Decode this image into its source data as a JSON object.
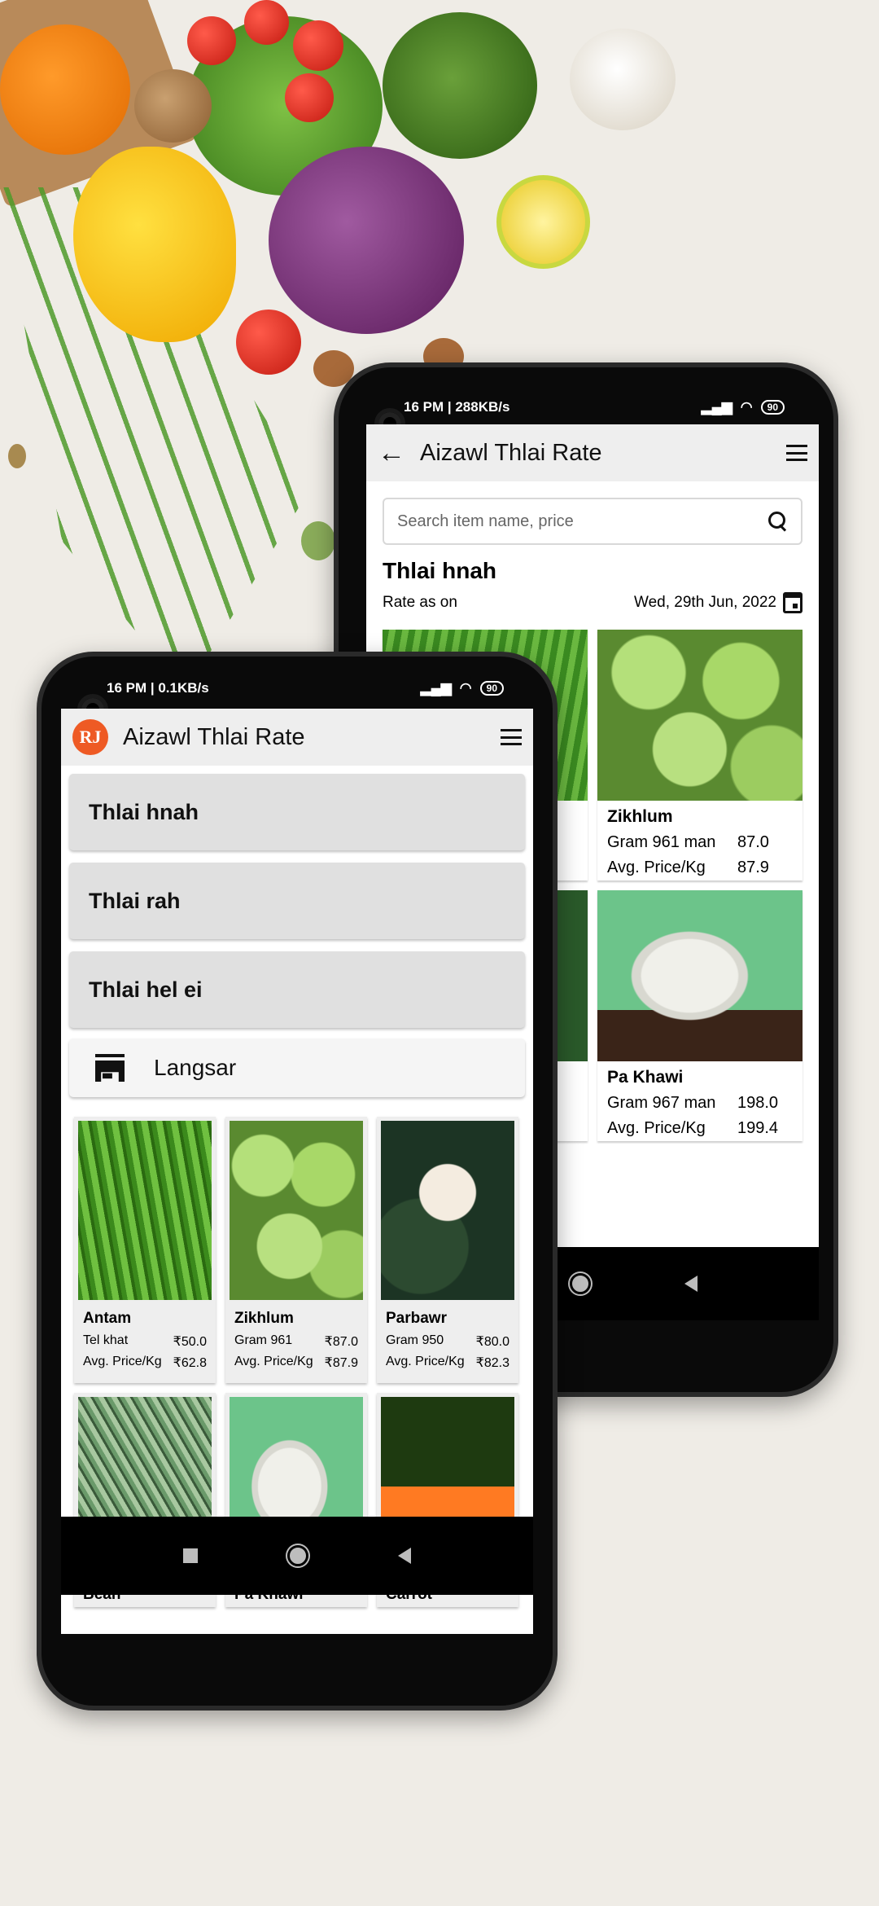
{
  "back_phone": {
    "status": {
      "time_speed": "16 PM | 288KB/s",
      "battery": "90"
    },
    "appbar": {
      "title": "Aizawl Thlai Rate"
    },
    "search": {
      "placeholder": "Search item name, price"
    },
    "section_title": "Thlai hnah",
    "rate_label": "Rate as on",
    "rate_date": "Wed, 29th Jun, 2022",
    "items": [
      {
        "name": "",
        "line1_label": "",
        "line1_value": "",
        "line2_label": "",
        "line2_value": ""
      },
      {
        "name": "Zikhlum",
        "line1_label": "Gram 961 man",
        "line1_value": "87.0",
        "line2_label": "Avg. Price/Kg",
        "line2_value": "87.9"
      },
      {
        "name": "",
        "line1_label": "",
        "line1_value": "",
        "line2_label": "",
        "line2_value": ""
      },
      {
        "name": "Pa Khawi",
        "line1_label": "Gram 967 man",
        "line1_value": "198.0",
        "line2_label": "Avg. Price/Kg",
        "line2_value": "199.4"
      }
    ]
  },
  "front_phone": {
    "status": {
      "time_speed": "16 PM | 0.1KB/s",
      "battery": "90"
    },
    "appbar": {
      "title": "Aizawl Thlai Rate",
      "logo_text": "RJ"
    },
    "categories": [
      "Thlai hnah",
      "Thlai rah",
      "Thlai hel ei"
    ],
    "shop_button": "Langsar",
    "items": [
      {
        "name": "Antam",
        "line1_label": "Tel khat",
        "line1_value": "₹50.0",
        "line2_label": "Avg. Price/Kg",
        "line2_value": "₹62.8"
      },
      {
        "name": "Zikhlum",
        "line1_label": "Gram 961",
        "line1_value": "₹87.0",
        "line2_label": "Avg. Price/Kg",
        "line2_value": "₹87.9"
      },
      {
        "name": "Parbawr",
        "line1_label": "Gram 950",
        "line1_value": "₹80.0",
        "line2_label": "Avg. Price/Kg",
        "line2_value": "₹82.3"
      },
      {
        "name": "Bean"
      },
      {
        "name": "Pa Khawi"
      },
      {
        "name": "Carrot"
      }
    ]
  },
  "colors": {
    "logo": "#ee5a24",
    "appbar_bg": "#eeeeee",
    "category_bg": "#e0e0e0"
  }
}
